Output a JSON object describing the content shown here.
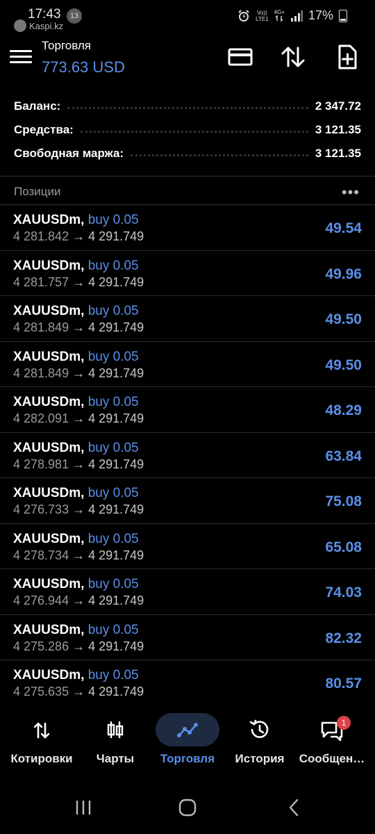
{
  "status_bar": {
    "time": "17:43",
    "notification_count": "13",
    "kaspi_label": "Kaspi.kz",
    "net_top": "Vo))",
    "net_bottom": "LTE1",
    "net_type": "4G+",
    "battery": "17%"
  },
  "header": {
    "title": "Торговля",
    "balance": "773.63 USD",
    "icons": [
      "card-icon",
      "sort-arrows-icon",
      "new-order-icon"
    ]
  },
  "account": {
    "rows": [
      {
        "label": "Баланс:",
        "value": "2 347.72"
      },
      {
        "label": "Средства:",
        "value": "3 121.35"
      },
      {
        "label": "Свободная маржа:",
        "value": "3 121.35"
      }
    ]
  },
  "positions": {
    "header": "Позиции",
    "more_icon": "more-dots-icon",
    "items": [
      {
        "symbol": "XAUUSDm,",
        "side": "buy 0.05",
        "open": "4 281.842",
        "arrow": "→",
        "current": "4 291.749",
        "profit": "49.54"
      },
      {
        "symbol": "XAUUSDm,",
        "side": "buy 0.05",
        "open": "4 281.757",
        "arrow": "→",
        "current": "4 291.749",
        "profit": "49.96"
      },
      {
        "symbol": "XAUUSDm,",
        "side": "buy 0.05",
        "open": "4 281.849",
        "arrow": "→",
        "current": "4 291.749",
        "profit": "49.50"
      },
      {
        "symbol": "XAUUSDm,",
        "side": "buy 0.05",
        "open": "4 281.849",
        "arrow": "→",
        "current": "4 291.749",
        "profit": "49.50"
      },
      {
        "symbol": "XAUUSDm,",
        "side": "buy 0.05",
        "open": "4 282.091",
        "arrow": "→",
        "current": "4 291.749",
        "profit": "48.29"
      },
      {
        "symbol": "XAUUSDm,",
        "side": "buy 0.05",
        "open": "4 278.981",
        "arrow": "→",
        "current": "4 291.749",
        "profit": "63.84"
      },
      {
        "symbol": "XAUUSDm,",
        "side": "buy 0.05",
        "open": "4 276.733",
        "arrow": "→",
        "current": "4 291.749",
        "profit": "75.08"
      },
      {
        "symbol": "XAUUSDm,",
        "side": "buy 0.05",
        "open": "4 278.734",
        "arrow": "→",
        "current": "4 291.749",
        "profit": "65.08"
      },
      {
        "symbol": "XAUUSDm,",
        "side": "buy 0.05",
        "open": "4 276.944",
        "arrow": "→",
        "current": "4 291.749",
        "profit": "74.03"
      },
      {
        "symbol": "XAUUSDm,",
        "side": "buy 0.05",
        "open": "4 275.286",
        "arrow": "→",
        "current": "4 291.749",
        "profit": "82.32"
      },
      {
        "symbol": "XAUUSDm,",
        "side": "buy 0.05",
        "open": "4 275.635",
        "arrow": "→",
        "current": "4 291.749",
        "profit": "80.57"
      }
    ]
  },
  "bottom_nav": {
    "items": [
      {
        "label": "Котировки",
        "icon": "quotes-arrows-icon"
      },
      {
        "label": "Чарты",
        "icon": "candlestick-icon"
      },
      {
        "label": "Торговля",
        "icon": "trade-line-icon",
        "active": true
      },
      {
        "label": "История",
        "icon": "history-icon"
      },
      {
        "label": "Сообщен…",
        "icon": "messages-icon",
        "badge": "1"
      }
    ]
  },
  "colors": {
    "accent": "#5a8fe8",
    "background": "#000000",
    "badge": "#e0404a"
  }
}
